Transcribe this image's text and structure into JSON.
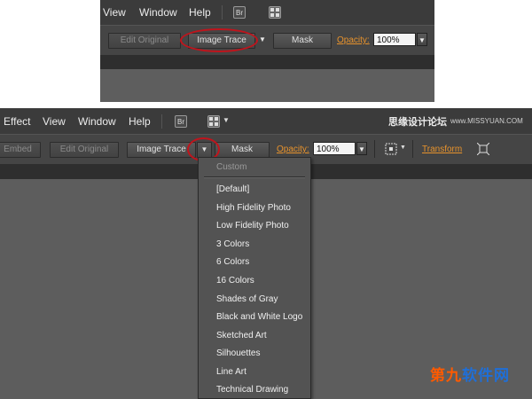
{
  "top_snippet": {
    "menu": [
      "View",
      "Window",
      "Help"
    ],
    "bridge_icon_text": "Br",
    "toolbar": {
      "edit_original": "Edit Original",
      "image_trace": "Image Trace",
      "mask": "Mask",
      "opacity_label": "Opacity:",
      "opacity_value": "100%"
    }
  },
  "main": {
    "menu": [
      "Effect",
      "View",
      "Window",
      "Help"
    ],
    "bridge_icon_text": "Br",
    "brand_text": "思缘设计论坛",
    "brand_url": "www.MISSYUAN.COM",
    "toolbar": {
      "embed": "Embed",
      "edit_original": "Edit Original",
      "image_trace": "Image Trace",
      "mask": "Mask",
      "opacity_label": "Opacity:",
      "opacity_value": "100%",
      "transform": "Transform"
    },
    "preset_menu": {
      "header": "Custom",
      "items": [
        "[Default]",
        "High Fidelity Photo",
        "Low Fidelity Photo",
        "3 Colors",
        "6 Colors",
        "16 Colors",
        "Shades of Gray",
        "Black and White Logo",
        "Sketched Art",
        "Silhouettes",
        "Line Art",
        "Technical Drawing"
      ]
    },
    "watermark": {
      "part1": "第九",
      "part2": "软件网"
    }
  },
  "colors": {
    "highlight_circle": "#c0141c",
    "link_orange": "#e8932c",
    "panel_bg": "#5d5d5d",
    "menubar_bg": "#3b3b3b"
  }
}
